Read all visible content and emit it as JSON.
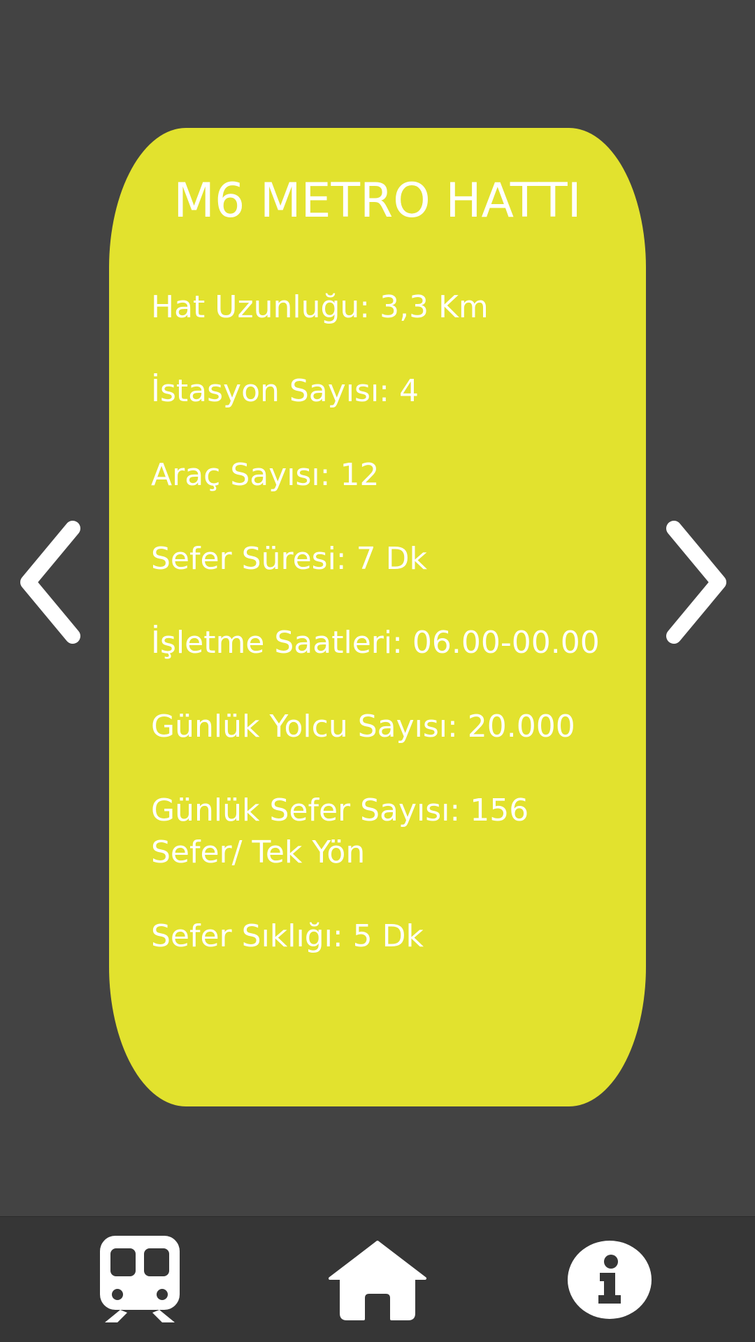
{
  "card": {
    "title": "M6 METRO HATTI",
    "background_color": "#e2e22e",
    "items": [
      {
        "text": "Hat Uzunluğu: 3,3 Km"
      },
      {
        "text": "İstasyon Sayısı: 4"
      },
      {
        "text": "Araç Sayısı: 12"
      },
      {
        "text": "Sefer Süresi: 7 Dk"
      },
      {
        "text": "İşletme Saatleri: 06.00-00.00"
      },
      {
        "text": "Günlük Yolcu Sayısı: 20.000"
      },
      {
        "text": "Günlük Sefer Sayısı: 156 Sefer/ Tek Yön"
      },
      {
        "text": "Sefer Sıklığı: 5 Dk"
      }
    ]
  },
  "navigation": {
    "previous_icon": "chevron-left-icon",
    "next_icon": "chevron-right-icon"
  },
  "bottom_bar": {
    "tabs": [
      {
        "icon": "train-icon"
      },
      {
        "icon": "home-icon"
      },
      {
        "icon": "info-icon"
      }
    ]
  },
  "colors": {
    "background": "#434343",
    "bottom_bar": "#363636",
    "text": "#ffffff"
  }
}
